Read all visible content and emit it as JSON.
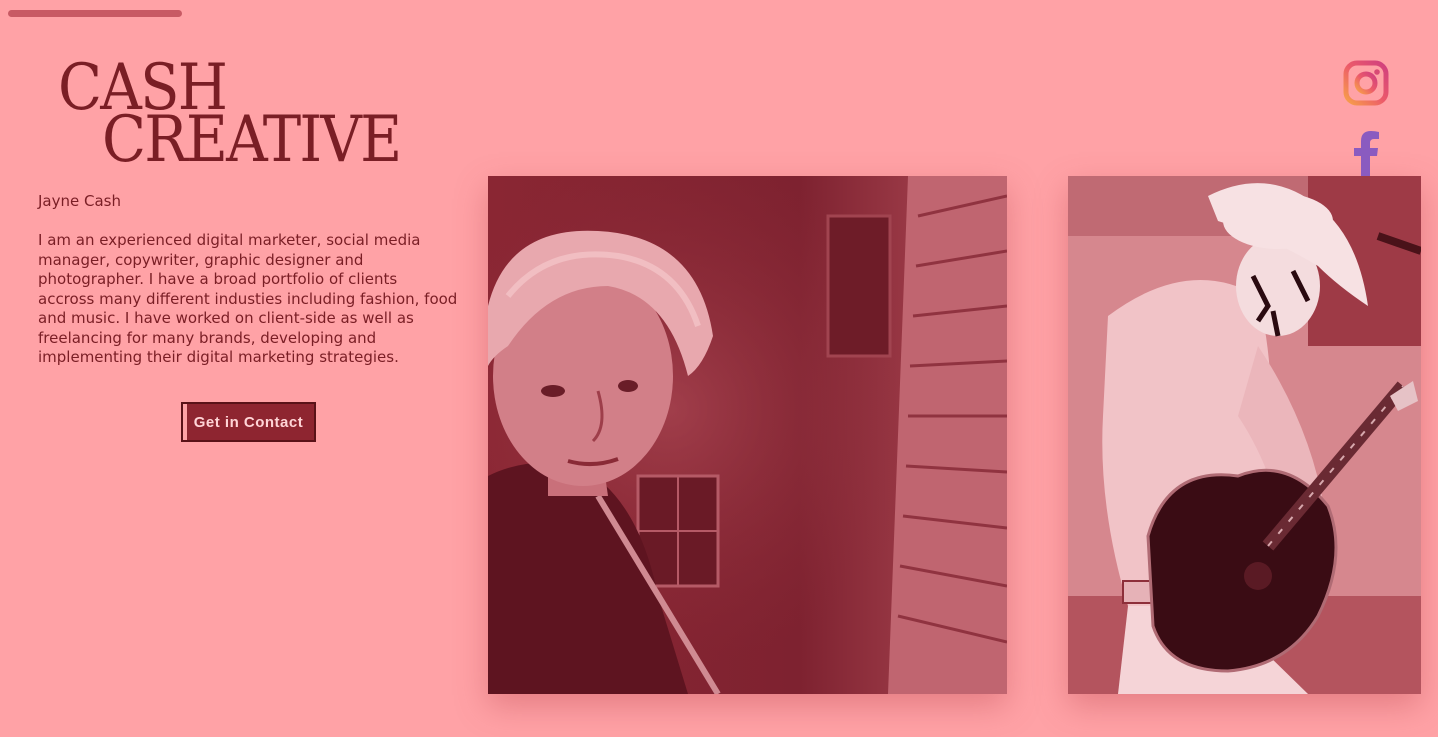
{
  "brand": {
    "logo_line1": "CASH",
    "logo_line2": "CREATIVE"
  },
  "profile": {
    "name": "Jayne Cash",
    "bio": "I am an experienced digital marketer, social media manager, copywriter, graphic designer and photographer. I have a broad portfolio of clients accross many different industies including fashion, food and music. I have worked on client-side as well as freelancing for many brands, developing and implementing their digital marketing strategies."
  },
  "cta": {
    "label": "Get in Contact"
  },
  "social": {
    "instagram_icon": "instagram-icon",
    "facebook_icon": "facebook-icon"
  },
  "colors": {
    "background": "#ffa2a6",
    "text": "#7a1e25",
    "button": "#8e2530"
  }
}
